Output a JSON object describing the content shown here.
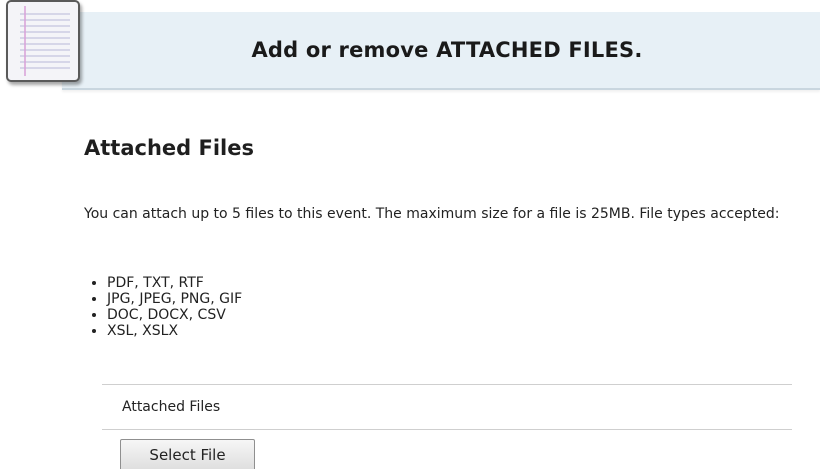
{
  "header": {
    "title": "Add or remove ATTACHED FILES."
  },
  "icons": {
    "header_icon": "notepad-icon"
  },
  "section": {
    "title": "Attached Files",
    "intro": "You can attach up to 5 files to this event. The maximum size for a file is 25MB. File types accepted:",
    "file_types": [
      "PDF, TXT, RTF",
      "JPG, JPEG, PNG, GIF",
      "DOC, DOCX, CSV",
      "XSL, XSLX"
    ]
  },
  "attachments": {
    "label": "Attached Files",
    "select_button_label": "Select File"
  },
  "colors": {
    "banner_background": "#e7f0f6",
    "banner_border": "#c9d6df",
    "text": "#222222",
    "divider": "#cfcfcf"
  }
}
